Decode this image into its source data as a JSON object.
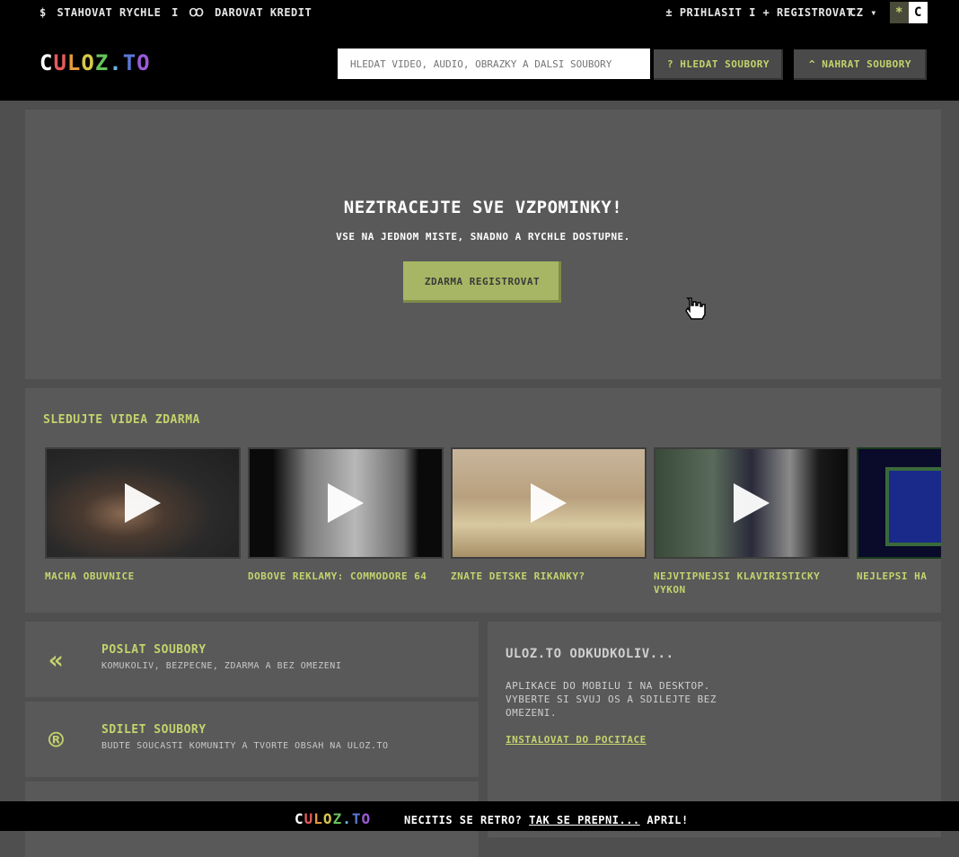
{
  "header": {
    "promo": {
      "icon": "$",
      "download_fast": "STAHOVAT RYCHLE",
      "separator": "I",
      "gift_icon": "ꝏ",
      "donate_credit": "DAROVAT KREDIT"
    },
    "account": {
      "login_icon": "±",
      "login": "PRIHLASIT",
      "separator": "I",
      "register_icon": "+",
      "register": "REGISTROVAT"
    },
    "language": "CZ",
    "theme_toggle": {
      "dark": "*",
      "light": "C"
    },
    "logo": {
      "c": "C",
      "text": "ULOZ.TO"
    },
    "search": {
      "placeholder": "HLEDAT VIDEO, AUDIO, OBRAZKY A DALSI SOUBORY",
      "button": "? HLEDAT SOUBORY"
    },
    "upload_button": "^ NAHRAT SOUBORY"
  },
  "hero": {
    "title": "NEZTRACEJTE SVE VZPOMINKY!",
    "subtitle": "VSE NA JEDNOM MISTE, SNADNO A RYCHLE DOSTUPNE.",
    "button": "ZDARMA REGISTROVAT"
  },
  "videos": {
    "title": "SLEDUJTE VIDEA ZDARMA",
    "items": [
      {
        "label": "MACHA OBUVNICE"
      },
      {
        "label": "DOBOVE REKLAMY: COMMODORE 64"
      },
      {
        "label": "ZNATE DETSKE RIKANKY?"
      },
      {
        "label": "NEJVTIPNEJSI KLAVIRISTICKY VYKON"
      },
      {
        "label": "NEJLEPSI HA"
      }
    ]
  },
  "features": [
    {
      "icon": "«",
      "title": "POSLAT SOUBORY",
      "subtitle": "KOMUKOLIV, BEZPECNE, ZDARMA A BEZ OMEZENI"
    },
    {
      "icon": "®",
      "title": "SDILET SOUBORY",
      "subtitle": "BUDTE SOUCASTI KOMUNITY A TVORTE OBSAH NA ULOZ.TO"
    }
  ],
  "apps": {
    "title": "ULOZ.TO ODKUDKOLIV...",
    "text": "APLIKACE DO MOBILU I NA DESKTOP. VYBERTE SI SVUJ OS A SDILEJTE BEZ OMEZENI.",
    "link": "INSTALOVAT DO POCITACE"
  },
  "footer": {
    "question": "NECITIS SE RETRO?",
    "link": "TAK SE PREPNI...",
    "suffix": "APRIL!"
  },
  "colors": {
    "accent": "#c5d36d",
    "background": "#4f4f4f",
    "panel": "#595959",
    "topbar": "#000000",
    "button_green": "#a6b664"
  }
}
